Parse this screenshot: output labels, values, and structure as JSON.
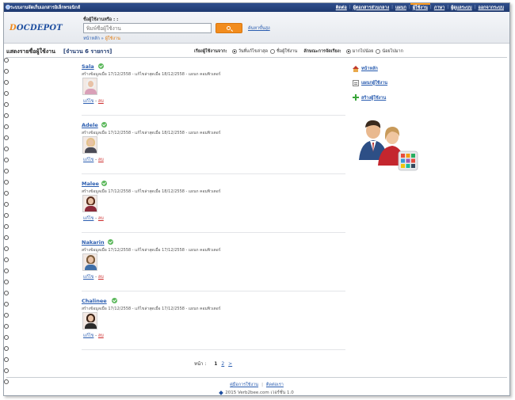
{
  "topbar": {
    "title": "ระบบงานจัดเก็บเอกสารอิเล็กทรอนิกส์",
    "menu": [
      {
        "label": "ติดต่อ",
        "active": false
      },
      {
        "label": "ผู้ตอกสารส่วนกลาง",
        "active": false
      },
      {
        "label": "แผนก",
        "active": false
      },
      {
        "label": "ผู้ใช้งาน",
        "active": true
      },
      {
        "label": "ภาษา",
        "active": false
      },
      {
        "label": "ผู้ดูแลระบบ",
        "active": false
      },
      {
        "label": "ออกจากระบบ",
        "active": false
      }
    ]
  },
  "header": {
    "logo": {
      "first": "D",
      "rest": "OCDEPOT"
    },
    "search_label": "ชื่อผู้ใช้งานหรือ : :",
    "search_placeholder": "พิมพ์ชื่อผู้ใช้งาน",
    "advanced_link": "ค้นหาขั้นสูง",
    "breadcrumb": {
      "home": "หน้าหลัก",
      "sep": " » ",
      "current": "ผู้ใช้งาน"
    }
  },
  "list": {
    "title": "แสดงรายชื่อผู้ใช้งาน",
    "count": "[จำนวน 6 รายการ]",
    "sort_label": "เรียงผู้ใช้งานจาก:",
    "sort_options": [
      "วันที่แก้ไขล่าสุด",
      "ชื่อผู้ใช้งาน"
    ],
    "order_label": "ลักษณะการจัดเรียง:",
    "order_options": [
      "มากไปน้อย",
      "น้อยไปมาก"
    ]
  },
  "users": [
    {
      "name": "Sala",
      "meta": "สร้างข้อมูลเมื่อ 17/12/2558 - แก้ไขล่าสุดเมื่อ 18/12/2558 - แผนก คอมพิวเตอร์",
      "edit": "แก้ไข",
      "sep": " - ",
      "delete": "ลบ",
      "avatar": {
        "hair": "#f0f0f0",
        "body": "#d9a0b8"
      }
    },
    {
      "name": "Adele",
      "meta": "สร้างข้อมูลเมื่อ 17/12/2558 - แก้ไขล่าสุดเมื่อ 18/12/2558 - แผนก คอมพิวเตอร์",
      "edit": "แก้ไข",
      "sep": " - ",
      "delete": "ลบ",
      "avatar": {
        "hair": "#e3c28a",
        "body": "#4a4a55"
      }
    },
    {
      "name": "Malee",
      "meta": "สร้างข้อมูลเมื่อ 17/12/2558 - แก้ไขล่าสุดเมื่อ 18/12/2558 - แผนก คอมพิวเตอร์",
      "edit": "แก้ไข",
      "sep": " - ",
      "delete": "ลบ",
      "avatar": {
        "hair": "#5a2d1c",
        "body": "#8c2a3a"
      }
    },
    {
      "name": "Nakarin",
      "meta": "สร้างข้อมูลเมื่อ 17/12/2558 - แก้ไขล่าสุดเมื่อ 17/12/2558 - แผนก คอมพิวเตอร์",
      "edit": "แก้ไข",
      "sep": " - ",
      "delete": "ลบ",
      "avatar": {
        "hair": "#7a5a3a",
        "body": "#3f6fa8"
      }
    },
    {
      "name": "Chalinee",
      "meta": "สร้างข้อมูลเมื่อ 17/12/2558 - แก้ไขล่าสุดเมื่อ 17/12/2558 - แผนก คอมพิวเตอร์",
      "edit": "แก้ไข",
      "sep": " - ",
      "delete": "ลบ",
      "avatar": {
        "hair": "#3a2418",
        "body": "#2b2b2b"
      }
    }
  ],
  "pager": {
    "label": "หน้า :",
    "current": "1",
    "next_page": "2",
    "next_arrow": ">"
  },
  "side": {
    "home": "หน้าหลัก",
    "manage": "แผนกผู้ใช้งาน",
    "create": "สร้างผู้ใช้งาน"
  },
  "footer": {
    "manual": "คู่มือการใช้งาน",
    "contact": "ติดต่อเรา",
    "copyright": "2015 Verb2bee.com เวอร์ชั่น 1.0"
  },
  "colors": {
    "topbar": "#1f3a70",
    "accent": "#f28c1d",
    "link": "#2a5db0",
    "delete": "#cc2a2a",
    "verified": "#5cb85c"
  }
}
